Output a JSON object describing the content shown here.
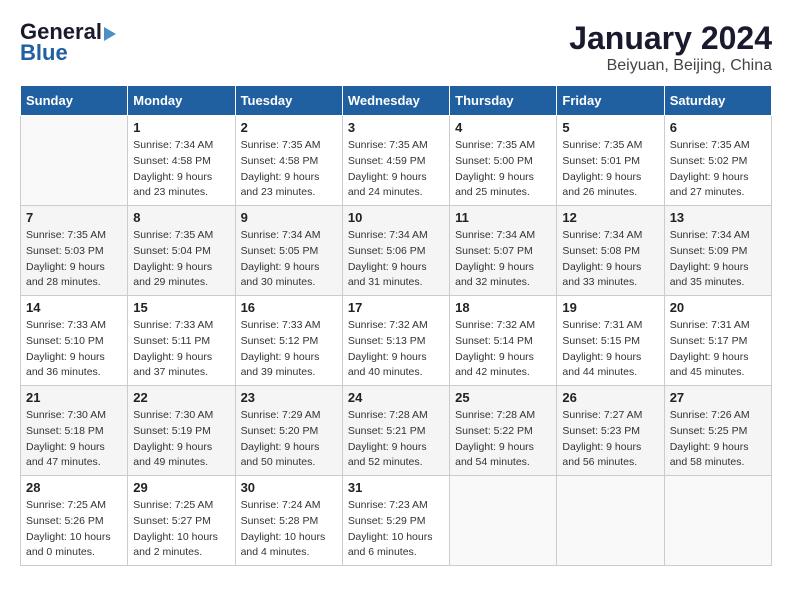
{
  "logo": {
    "line1": "General",
    "line2": "Blue"
  },
  "title": "January 2024",
  "location": "Beiyuan, Beijing, China",
  "days_of_week": [
    "Sunday",
    "Monday",
    "Tuesday",
    "Wednesday",
    "Thursday",
    "Friday",
    "Saturday"
  ],
  "weeks": [
    [
      {
        "day": "",
        "sunrise": "",
        "sunset": "",
        "daylight": ""
      },
      {
        "day": "1",
        "sunrise": "Sunrise: 7:34 AM",
        "sunset": "Sunset: 4:58 PM",
        "daylight": "Daylight: 9 hours and 23 minutes."
      },
      {
        "day": "2",
        "sunrise": "Sunrise: 7:35 AM",
        "sunset": "Sunset: 4:58 PM",
        "daylight": "Daylight: 9 hours and 23 minutes."
      },
      {
        "day": "3",
        "sunrise": "Sunrise: 7:35 AM",
        "sunset": "Sunset: 4:59 PM",
        "daylight": "Daylight: 9 hours and 24 minutes."
      },
      {
        "day": "4",
        "sunrise": "Sunrise: 7:35 AM",
        "sunset": "Sunset: 5:00 PM",
        "daylight": "Daylight: 9 hours and 25 minutes."
      },
      {
        "day": "5",
        "sunrise": "Sunrise: 7:35 AM",
        "sunset": "Sunset: 5:01 PM",
        "daylight": "Daylight: 9 hours and 26 minutes."
      },
      {
        "day": "6",
        "sunrise": "Sunrise: 7:35 AM",
        "sunset": "Sunset: 5:02 PM",
        "daylight": "Daylight: 9 hours and 27 minutes."
      }
    ],
    [
      {
        "day": "7",
        "sunrise": "Sunrise: 7:35 AM",
        "sunset": "Sunset: 5:03 PM",
        "daylight": "Daylight: 9 hours and 28 minutes."
      },
      {
        "day": "8",
        "sunrise": "Sunrise: 7:35 AM",
        "sunset": "Sunset: 5:04 PM",
        "daylight": "Daylight: 9 hours and 29 minutes."
      },
      {
        "day": "9",
        "sunrise": "Sunrise: 7:34 AM",
        "sunset": "Sunset: 5:05 PM",
        "daylight": "Daylight: 9 hours and 30 minutes."
      },
      {
        "day": "10",
        "sunrise": "Sunrise: 7:34 AM",
        "sunset": "Sunset: 5:06 PM",
        "daylight": "Daylight: 9 hours and 31 minutes."
      },
      {
        "day": "11",
        "sunrise": "Sunrise: 7:34 AM",
        "sunset": "Sunset: 5:07 PM",
        "daylight": "Daylight: 9 hours and 32 minutes."
      },
      {
        "day": "12",
        "sunrise": "Sunrise: 7:34 AM",
        "sunset": "Sunset: 5:08 PM",
        "daylight": "Daylight: 9 hours and 33 minutes."
      },
      {
        "day": "13",
        "sunrise": "Sunrise: 7:34 AM",
        "sunset": "Sunset: 5:09 PM",
        "daylight": "Daylight: 9 hours and 35 minutes."
      }
    ],
    [
      {
        "day": "14",
        "sunrise": "Sunrise: 7:33 AM",
        "sunset": "Sunset: 5:10 PM",
        "daylight": "Daylight: 9 hours and 36 minutes."
      },
      {
        "day": "15",
        "sunrise": "Sunrise: 7:33 AM",
        "sunset": "Sunset: 5:11 PM",
        "daylight": "Daylight: 9 hours and 37 minutes."
      },
      {
        "day": "16",
        "sunrise": "Sunrise: 7:33 AM",
        "sunset": "Sunset: 5:12 PM",
        "daylight": "Daylight: 9 hours and 39 minutes."
      },
      {
        "day": "17",
        "sunrise": "Sunrise: 7:32 AM",
        "sunset": "Sunset: 5:13 PM",
        "daylight": "Daylight: 9 hours and 40 minutes."
      },
      {
        "day": "18",
        "sunrise": "Sunrise: 7:32 AM",
        "sunset": "Sunset: 5:14 PM",
        "daylight": "Daylight: 9 hours and 42 minutes."
      },
      {
        "day": "19",
        "sunrise": "Sunrise: 7:31 AM",
        "sunset": "Sunset: 5:15 PM",
        "daylight": "Daylight: 9 hours and 44 minutes."
      },
      {
        "day": "20",
        "sunrise": "Sunrise: 7:31 AM",
        "sunset": "Sunset: 5:17 PM",
        "daylight": "Daylight: 9 hours and 45 minutes."
      }
    ],
    [
      {
        "day": "21",
        "sunrise": "Sunrise: 7:30 AM",
        "sunset": "Sunset: 5:18 PM",
        "daylight": "Daylight: 9 hours and 47 minutes."
      },
      {
        "day": "22",
        "sunrise": "Sunrise: 7:30 AM",
        "sunset": "Sunset: 5:19 PM",
        "daylight": "Daylight: 9 hours and 49 minutes."
      },
      {
        "day": "23",
        "sunrise": "Sunrise: 7:29 AM",
        "sunset": "Sunset: 5:20 PM",
        "daylight": "Daylight: 9 hours and 50 minutes."
      },
      {
        "day": "24",
        "sunrise": "Sunrise: 7:28 AM",
        "sunset": "Sunset: 5:21 PM",
        "daylight": "Daylight: 9 hours and 52 minutes."
      },
      {
        "day": "25",
        "sunrise": "Sunrise: 7:28 AM",
        "sunset": "Sunset: 5:22 PM",
        "daylight": "Daylight: 9 hours and 54 minutes."
      },
      {
        "day": "26",
        "sunrise": "Sunrise: 7:27 AM",
        "sunset": "Sunset: 5:23 PM",
        "daylight": "Daylight: 9 hours and 56 minutes."
      },
      {
        "day": "27",
        "sunrise": "Sunrise: 7:26 AM",
        "sunset": "Sunset: 5:25 PM",
        "daylight": "Daylight: 9 hours and 58 minutes."
      }
    ],
    [
      {
        "day": "28",
        "sunrise": "Sunrise: 7:25 AM",
        "sunset": "Sunset: 5:26 PM",
        "daylight": "Daylight: 10 hours and 0 minutes."
      },
      {
        "day": "29",
        "sunrise": "Sunrise: 7:25 AM",
        "sunset": "Sunset: 5:27 PM",
        "daylight": "Daylight: 10 hours and 2 minutes."
      },
      {
        "day": "30",
        "sunrise": "Sunrise: 7:24 AM",
        "sunset": "Sunset: 5:28 PM",
        "daylight": "Daylight: 10 hours and 4 minutes."
      },
      {
        "day": "31",
        "sunrise": "Sunrise: 7:23 AM",
        "sunset": "Sunset: 5:29 PM",
        "daylight": "Daylight: 10 hours and 6 minutes."
      },
      {
        "day": "",
        "sunrise": "",
        "sunset": "",
        "daylight": ""
      },
      {
        "day": "",
        "sunrise": "",
        "sunset": "",
        "daylight": ""
      },
      {
        "day": "",
        "sunrise": "",
        "sunset": "",
        "daylight": ""
      }
    ]
  ]
}
